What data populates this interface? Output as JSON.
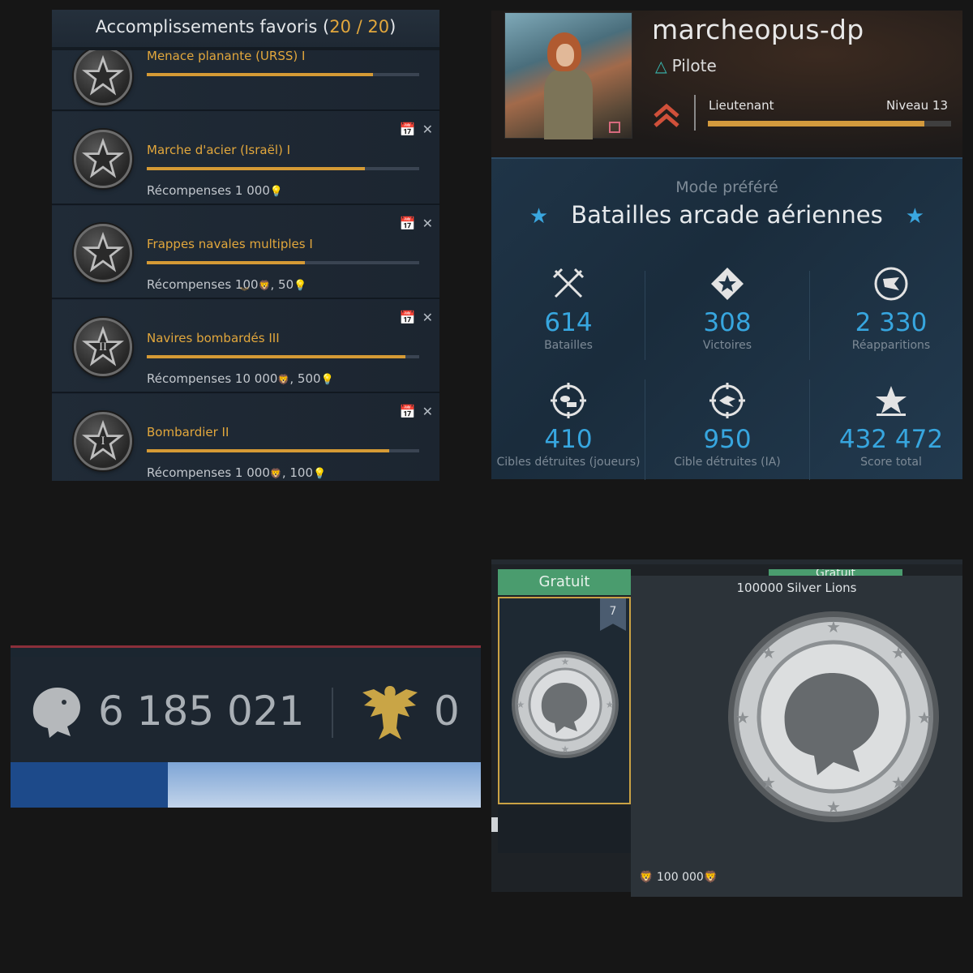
{
  "achievements": {
    "header_label": "Accomplissements favoris (",
    "header_count": "20 / 20",
    "header_close": ")",
    "partial_item_title": "Menace planante (URSS) I",
    "items": [
      {
        "title": "Marche d'acier (Israël) I",
        "progress": 0.8,
        "reward_label": "Récompenses",
        "reward_parts": [
          "1 000"
        ],
        "roman": ""
      },
      {
        "title": "Frappes navales multiples I",
        "progress": 0.58,
        "reward_label": "Récompenses",
        "reward_parts": [
          "100",
          ", 50"
        ],
        "roman": ""
      },
      {
        "title": "Navires bombardés III",
        "progress": 0.95,
        "reward_label": "Récompenses",
        "reward_parts": [
          "10 000",
          ", 500"
        ],
        "roman": "II"
      },
      {
        "title": "Bombardier II",
        "progress": 0.89,
        "reward_label": "Récompenses",
        "reward_parts": [
          "1 000",
          ", 100"
        ],
        "roman": "I"
      }
    ],
    "partial_progress": 0.83
  },
  "profile": {
    "name": "marcheopus-dp",
    "role": "Pilote",
    "rank": "Lieutenant",
    "level_label": "Niveau 13",
    "level_progress": 0.9
  },
  "stats": {
    "mode_label": "Mode préféré",
    "mode": "Batailles arcade aériennes",
    "items": [
      {
        "value": "614",
        "label": "Batailles",
        "icon": "crossed-swords-icon"
      },
      {
        "value": "308",
        "label": "Victoires",
        "icon": "victory-star-icon"
      },
      {
        "value": "2 330",
        "label": "Réapparitions",
        "icon": "flag-circle-icon"
      },
      {
        "value": "410",
        "label": "Cibles détruites (joueurs)",
        "icon": "target-players-icon"
      },
      {
        "value": "950",
        "label": "Cible détruites (IA)",
        "icon": "target-ai-icon"
      },
      {
        "value": "432 472",
        "label": "Score total",
        "icon": "stars-icon"
      }
    ]
  },
  "currency": {
    "silver_lions": "6 185 021",
    "golden_eagles": "0"
  },
  "reward": {
    "tab_free": "Gratuit",
    "tab_free_2": "Gratuit",
    "ribbon_number": "7",
    "title": "100000 Silver Lions",
    "price": "100 000"
  },
  "colors": {
    "accent_gold": "#e2a73c",
    "accent_blue": "#37a6df",
    "free_green": "#4a9c6e"
  }
}
